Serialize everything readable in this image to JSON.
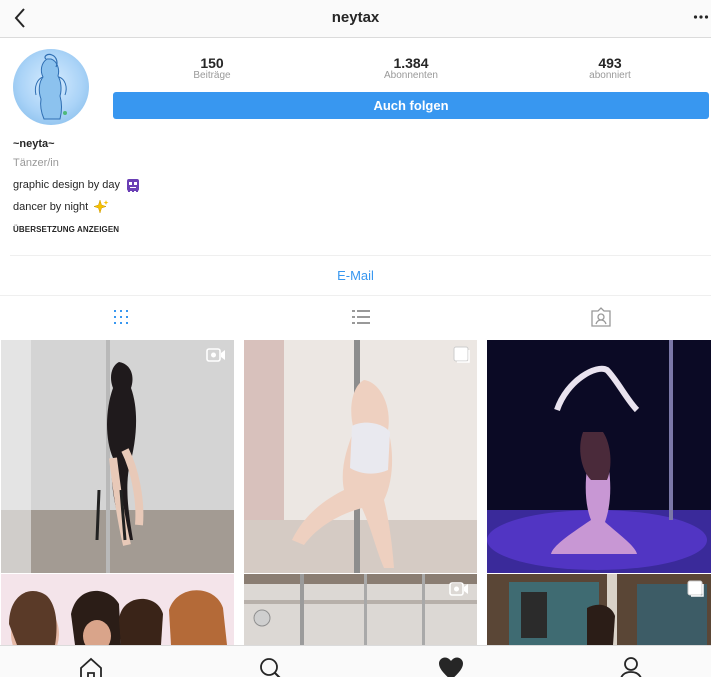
{
  "header": {
    "username": "neytax",
    "back_icon": "chevron-left-icon",
    "more_icon": "more-dots-icon"
  },
  "profile": {
    "stats": [
      {
        "value": "150",
        "label": "Beiträge"
      },
      {
        "value": "1.384",
        "label": "Abonnenten"
      },
      {
        "value": "493",
        "label": "abonniert"
      }
    ],
    "follow_label": "Auch folgen",
    "display_name": "~neyta~",
    "category": "Tänzer/in",
    "bio_line1": "graphic design by day",
    "bio_line2": "dancer by night",
    "translate_label": "ÜBERSETZUNG ANZEIGEN",
    "email_label": "E-Mail"
  },
  "tabs": [
    "grid-icon",
    "list-icon",
    "tagged-icon"
  ],
  "posts": [
    {
      "badge": "video-icon"
    },
    {
      "badge": "carousel-icon"
    },
    {
      "badge": ""
    },
    {
      "badge": ""
    },
    {
      "badge": "video-icon"
    },
    {
      "badge": "carousel-icon"
    }
  ],
  "bottom_nav": [
    "home-icon",
    "search-icon",
    "heart-icon",
    "profile-icon"
  ],
  "colors": {
    "accent": "#3897f0",
    "text": "#262626",
    "muted": "#999999",
    "border": "#dbdbdb"
  }
}
